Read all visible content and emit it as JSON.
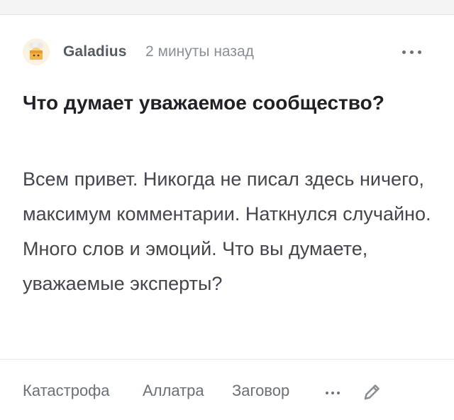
{
  "post": {
    "author": "Galadius",
    "time": "2 минуты назад",
    "title": "Что думает уважаемое сообщество?",
    "body": "Всем привет. Никогда не писал здесь ничего, максимум комментарии. Наткнулся случайно. Много слов и эмоций. Что вы думаете, уважаемые эксперты?"
  },
  "tags": [
    "Катастрофа",
    "Аллатра",
    "Заговор"
  ],
  "icons": {
    "avatar": "avatar",
    "more_top": "more-horizontal-icon",
    "more_tags": "more-horizontal-icon",
    "edit": "pencil-icon"
  },
  "colors": {
    "author": "#555b63",
    "muted": "#8a8f96",
    "title": "#1f2126",
    "body": "#42464d"
  }
}
